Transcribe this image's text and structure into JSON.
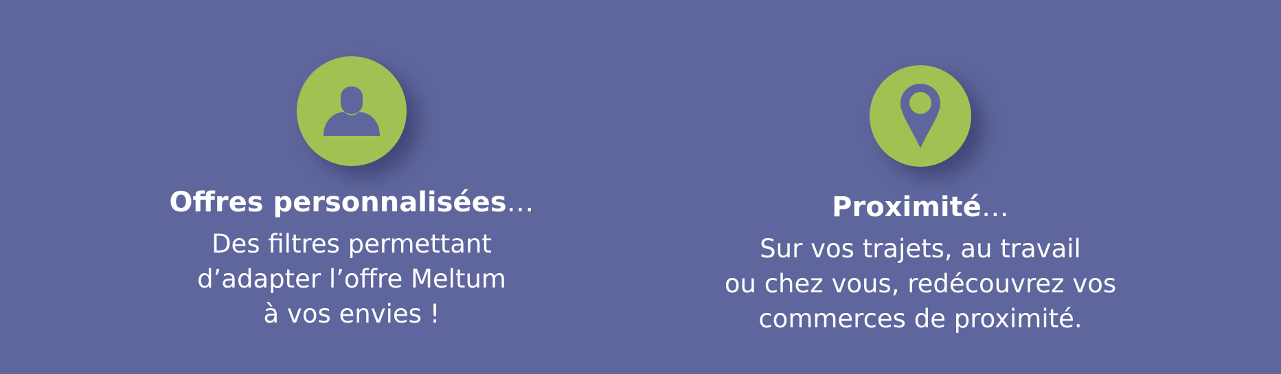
{
  "colors": {
    "background": "#5f669d",
    "accent": "#a2c152",
    "text": "#ffffff"
  },
  "features": [
    {
      "icon": "user-icon",
      "title": "Offres personnalisées",
      "title_suffix": "…",
      "description": [
        "Des filtres permettant",
        "d’adapter l’offre Meltum",
        "à vos envies !"
      ]
    },
    {
      "icon": "location-pin-icon",
      "title": "Proximité",
      "title_suffix": "…",
      "description": [
        "Sur vos trajets, au travail",
        "ou chez vous, redécouvrez vos",
        "commerces de proximité."
      ]
    }
  ]
}
